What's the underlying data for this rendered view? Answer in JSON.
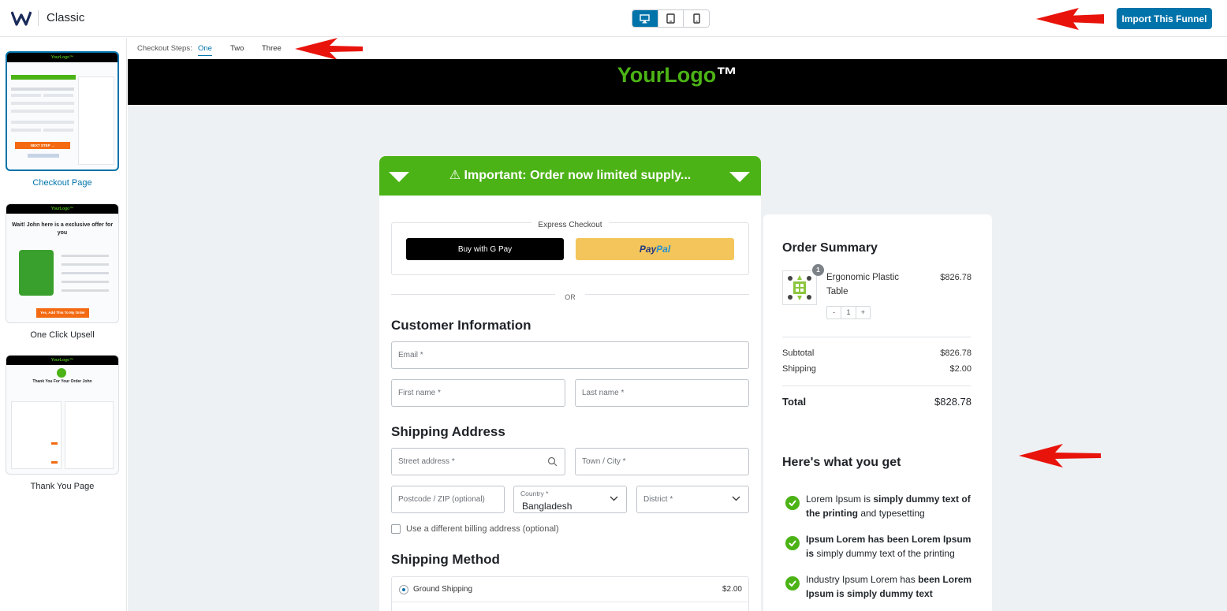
{
  "header": {
    "app_title": "Classic",
    "import_label": "Import This Funnel",
    "devices": [
      "desktop-icon",
      "tablet-icon",
      "mobile-icon"
    ],
    "active_device": "desktop"
  },
  "sidebar": {
    "items": [
      {
        "label": "Checkout Page",
        "active": true
      },
      {
        "label": "One Click Upsell",
        "active": false
      },
      {
        "label": "Thank You Page",
        "active": false
      }
    ],
    "thumb_logo": "YourLogo™",
    "upsell_heading": "Wait! John here is a exclusive offer for you",
    "upsell_cta": "Yes, Add This To My Order",
    "thankyou_heading": "Thank You For Your Order John",
    "checkout_cta": "NEXT STEP →"
  },
  "steps": {
    "label": "Checkout Steps:",
    "items": [
      "One",
      "Two",
      "Three"
    ],
    "active": "One"
  },
  "page": {
    "logo_green": "YourLogo",
    "logo_white": "™",
    "banner": "⚠ Important: Order now limited supply...",
    "express_label": "Express Checkout",
    "gpay_label": "Buy with G Pay",
    "paypal_1": "Pay",
    "paypal_2": "Pal",
    "or": "OR",
    "customer_title": "Customer Information",
    "email_ph": "Email *",
    "first_ph": "First name *",
    "last_ph": "Last name *",
    "shipping_title": "Shipping Address",
    "street_ph": "Street address *",
    "town_ph": "Town / City *",
    "postcode_ph": "Postcode / ZIP (optional)",
    "country_label": "Country *",
    "country_value": "Bangladesh",
    "district_ph": "District *",
    "billing_check": "Use a different billing address (optional)",
    "method_title": "Shipping Method",
    "ship_option": "Ground Shipping",
    "ship_price": "$2.00"
  },
  "summary": {
    "title": "Order Summary",
    "product_name": "Ergonomic Plastic Table",
    "product_price": "$826.78",
    "qty_badge": "1",
    "stepper": [
      "-",
      "1",
      "+"
    ],
    "subtotal_label": "Subtotal",
    "subtotal": "$826.78",
    "shipping_label": "Shipping",
    "shipping": "$2.00",
    "total_label": "Total",
    "total": "$828.78",
    "get_title": "Here's what you get",
    "benefits": [
      {
        "a": "Lorem Ipsum is ",
        "b": "simply dummy text of the printing",
        "c": " and typesetting"
      },
      {
        "a": "",
        "b": "Ipsum Lorem has been Lorem Ipsum is",
        "c": " simply dummy text of the printing"
      },
      {
        "a": "Industry Ipsum Lorem has ",
        "b": "been Lorem Ipsum is simply dummy text",
        "c": ""
      }
    ]
  },
  "colors": {
    "accent": "#0073aa",
    "brand_green": "#4cb316",
    "annotation_red": "#e8140c"
  }
}
